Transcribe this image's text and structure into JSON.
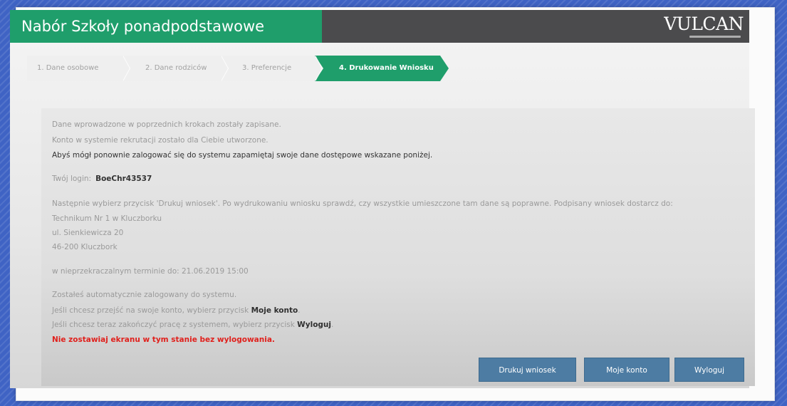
{
  "header": {
    "title": "Nabór Szkoły ponadpodstawowe",
    "logo": "VULCAN"
  },
  "steps": [
    {
      "label": "1. Dane osobowe"
    },
    {
      "label": "2. Dane rodziców"
    },
    {
      "label": "3. Preferencje"
    },
    {
      "label": "4. Drukowanie Wniosku"
    }
  ],
  "message": {
    "line1": "Dane wprowadzone w poprzednich krokach zostały zapisane.",
    "line2": "Konto w systemie rekrutacji zostało dla Ciebie utworzone.",
    "line3": "Abyś mógł ponownie zalogować się do systemu zapamiętaj swoje dane dostępowe wskazane poniżej.",
    "login_label": "Twój login:",
    "login_value": "BoeChr43537",
    "instructions": "Następnie wybierz przycisk 'Drukuj wniosek'. Po wydrukowaniu wniosku sprawdź, czy wszystkie umieszczone tam dane są poprawne. Podpisany wniosek dostarcz do:",
    "school_name": "Technikum Nr 1 w Kluczborku",
    "school_street": "ul. Sienkiewicza 20",
    "school_city": "46-200 Kluczbork",
    "deadline": "w nieprzekraczalnym terminie do: 21.06.2019 15:00",
    "auto_login": "Zostałeś automatycznie zalogowany do systemu.",
    "account_hint_prefix": "Jeśli chcesz przejść na swoje konto, wybierz przycisk",
    "account_hint_button": "Moje konto",
    "logout_hint_prefix": "Jeśli chcesz teraz zakończyć pracę z systemem, wybierz przycisk",
    "logout_hint_button": "Wyloguj",
    "warning": "Nie zostawiaj ekranu w tym stanie bez wylogowania."
  },
  "buttons": {
    "print": "Drukuj wniosek",
    "account": "Moje konto",
    "logout": "Wyloguj"
  },
  "colors": {
    "accent_green": "#1f9e6b",
    "header_dark": "#4b4b4d",
    "button_blue": "#4d7ca3",
    "warning_red": "#e0201c"
  }
}
